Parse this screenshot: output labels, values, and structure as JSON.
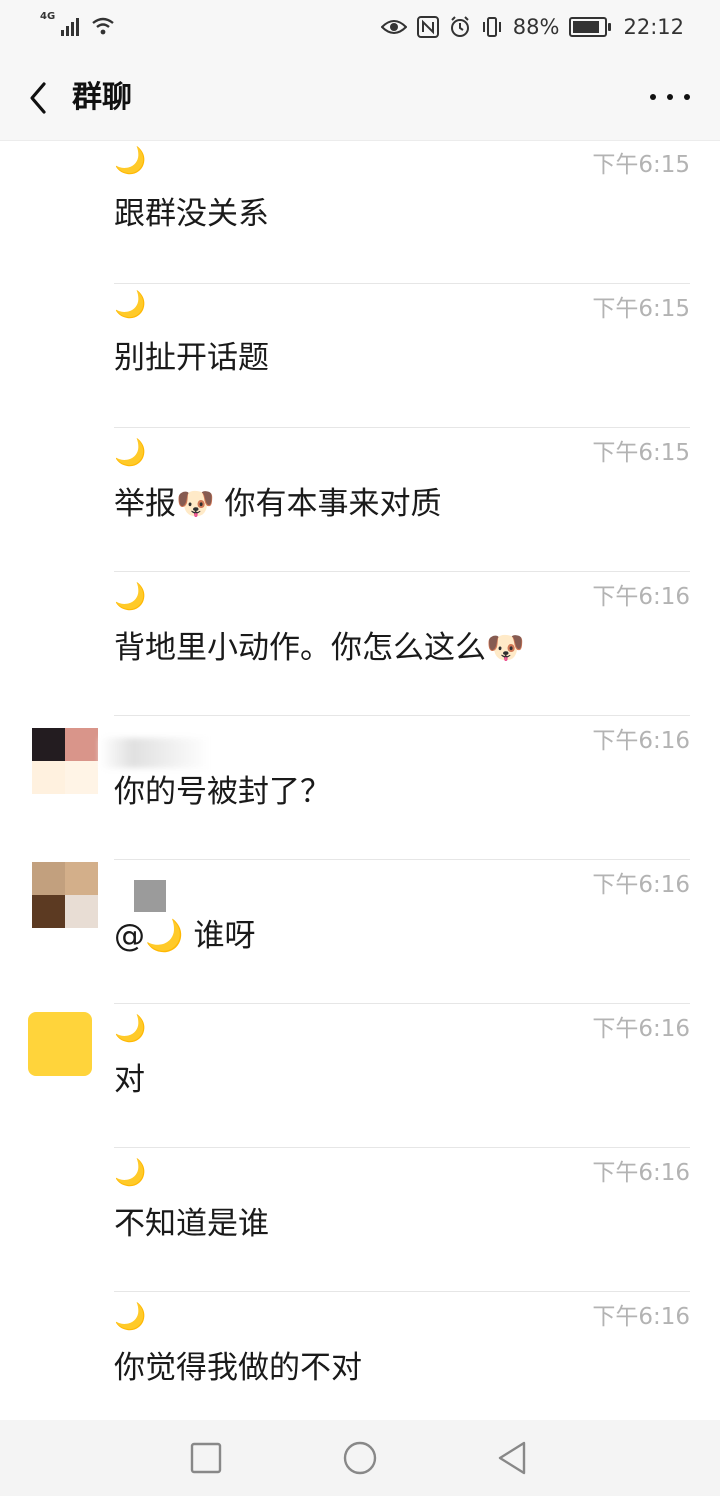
{
  "status_bar": {
    "network": "4G",
    "battery": "88%",
    "battery_level": 0.88,
    "time": "22:12"
  },
  "header": {
    "title": "群聊"
  },
  "messages": [
    {
      "nick": "🌙",
      "time": "下午6:15",
      "text": "跟群没关系",
      "avatar": "none"
    },
    {
      "nick": "🌙",
      "time": "下午6:15",
      "text": "别扯开话题",
      "avatar": "none"
    },
    {
      "nick": "🌙",
      "time": "下午6:15",
      "text": "举报🐶 你有本事来对质",
      "avatar": "none"
    },
    {
      "nick": "🌙",
      "time": "下午6:16",
      "text": "背地里小动作。你怎么这么🐶",
      "avatar": "none"
    },
    {
      "nick": "",
      "time": "下午6:16",
      "text": "你的号被封了？",
      "avatar": "pixelated-1"
    },
    {
      "nick": "",
      "time": "下午6:16",
      "text": "@🌙 谁呀",
      "avatar": "pixelated-2"
    },
    {
      "nick": "🌙",
      "time": "下午6:16",
      "text": "对",
      "avatar": "yellow"
    },
    {
      "nick": "🌙",
      "time": "下午6:16",
      "text": "不知道是谁",
      "avatar": "none"
    },
    {
      "nick": "🌙",
      "time": "下午6:16",
      "text": "你觉得我做的不对",
      "avatar": "none"
    }
  ],
  "colors": {
    "header_bg": "#f7f7f7",
    "time_text": "#b3b3b3",
    "avatar_yellow": "#ffd43b"
  },
  "icons": {
    "back": "chevron-left-icon",
    "more": "more-dots-icon",
    "nav": [
      "recent-apps-icon",
      "home-icon",
      "back-triangle-icon"
    ]
  }
}
